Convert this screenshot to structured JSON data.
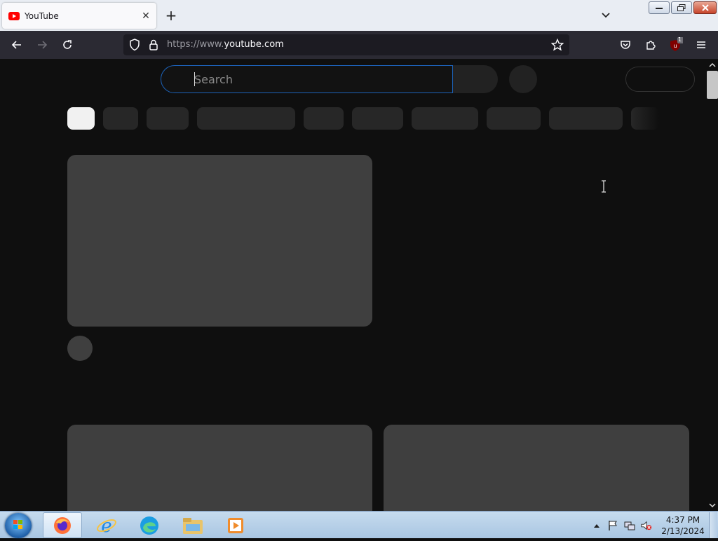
{
  "browser": {
    "tab": {
      "title": "YouTube"
    },
    "url": {
      "scheme": "https://www.",
      "host": "youtube.com"
    },
    "extension_badge": "1"
  },
  "page": {
    "search": {
      "placeholder": "Search"
    },
    "chip_count": 10,
    "colors": {
      "background": "#0f0f0f",
      "skeleton": "#3f3f3f",
      "chip": "#272727",
      "chip_active": "#f1f1f1",
      "search_focus": "#1c62b9"
    }
  },
  "taskbar": {
    "clock": {
      "time": "4:37 PM",
      "date": "2/13/2024"
    },
    "apps": [
      "firefox-icon",
      "internet-explorer-icon",
      "edge-icon",
      "file-explorer-icon",
      "media-player-icon"
    ]
  }
}
